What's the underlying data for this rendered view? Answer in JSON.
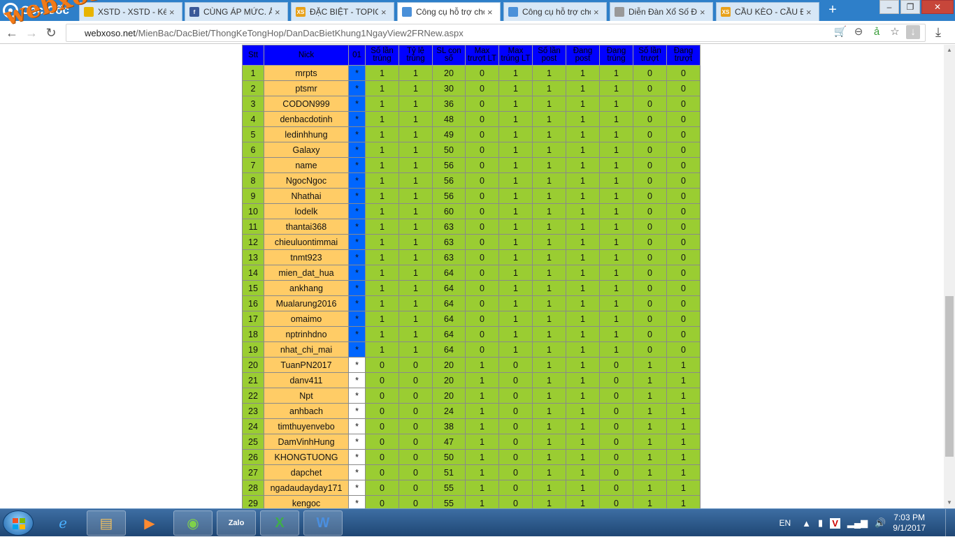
{
  "browser": {
    "brand": "Cốc Cốc",
    "watermark": "webxoso.net",
    "tabs": [
      {
        "title": "XSTD - XSTD - Kết",
        "icon": "chrome-icon",
        "favcolor": "#e8b400",
        "favtext": "",
        "active": false
      },
      {
        "title": "CÙNG ÁP MỨC. Ấn",
        "icon": "facebook-icon",
        "favcolor": "#3b5998",
        "favtext": "f",
        "active": false
      },
      {
        "title": "ĐẶC BIỆT - TOPIC",
        "icon": "xs-icon",
        "favcolor": "#e8a11a",
        "favtext": "XS",
        "active": false
      },
      {
        "title": "Công cụ hỗ trợ chơ",
        "icon": "tool-icon",
        "favcolor": "#4a90d9",
        "favtext": "",
        "active": true
      },
      {
        "title": "Công cụ hỗ trợ chơ",
        "icon": "tool-icon",
        "favcolor": "#4a90d9",
        "favtext": "",
        "active": false
      },
      {
        "title": "Diễn Đàn Xổ Số Đi",
        "icon": "page-icon",
        "favcolor": "#999999",
        "favtext": "",
        "active": false
      },
      {
        "title": "CẦU KÈO - CẦU ĐI",
        "icon": "xs-icon",
        "favcolor": "#e8a11a",
        "favtext": "XS",
        "active": false
      }
    ],
    "url_host": "webxoso.net",
    "url_path": "/MienBac/DacBiet/ThongKeTongHop/DanDacBietKhung1NgayView2FRNew.aspx"
  },
  "table": {
    "headers": [
      "Stt",
      "Nick",
      "01",
      "Số lần trúng",
      "Tỷ lệ trúng",
      "SL con số",
      "Max trượt LT",
      "Max trúng LT",
      "Số lần post",
      "Đang post",
      "Đang trúng",
      "Số lần trượt",
      "Đang trượt"
    ],
    "rows": [
      [
        "1",
        "mrpts",
        "*",
        "1",
        "1",
        "20",
        "0",
        "1",
        "1",
        "1",
        "1",
        "0",
        "0"
      ],
      [
        "2",
        "ptsmr",
        "*",
        "1",
        "1",
        "30",
        "0",
        "1",
        "1",
        "1",
        "1",
        "0",
        "0"
      ],
      [
        "3",
        "CODON999",
        "*",
        "1",
        "1",
        "36",
        "0",
        "1",
        "1",
        "1",
        "1",
        "0",
        "0"
      ],
      [
        "4",
        "denbacdotinh",
        "*",
        "1",
        "1",
        "48",
        "0",
        "1",
        "1",
        "1",
        "1",
        "0",
        "0"
      ],
      [
        "5",
        "ledinhhung",
        "*",
        "1",
        "1",
        "49",
        "0",
        "1",
        "1",
        "1",
        "1",
        "0",
        "0"
      ],
      [
        "6",
        "Galaxy",
        "*",
        "1",
        "1",
        "50",
        "0",
        "1",
        "1",
        "1",
        "1",
        "0",
        "0"
      ],
      [
        "7",
        "name",
        "*",
        "1",
        "1",
        "56",
        "0",
        "1",
        "1",
        "1",
        "1",
        "0",
        "0"
      ],
      [
        "8",
        "NgocNgoc",
        "*",
        "1",
        "1",
        "56",
        "0",
        "1",
        "1",
        "1",
        "1",
        "0",
        "0"
      ],
      [
        "9",
        "Nhathai",
        "*",
        "1",
        "1",
        "56",
        "0",
        "1",
        "1",
        "1",
        "1",
        "0",
        "0"
      ],
      [
        "10",
        "lodelk",
        "*",
        "1",
        "1",
        "60",
        "0",
        "1",
        "1",
        "1",
        "1",
        "0",
        "0"
      ],
      [
        "11",
        "thantai368",
        "*",
        "1",
        "1",
        "63",
        "0",
        "1",
        "1",
        "1",
        "1",
        "0",
        "0"
      ],
      [
        "12",
        "chieuluontimmai",
        "*",
        "1",
        "1",
        "63",
        "0",
        "1",
        "1",
        "1",
        "1",
        "0",
        "0"
      ],
      [
        "13",
        "tnmt923",
        "*",
        "1",
        "1",
        "63",
        "0",
        "1",
        "1",
        "1",
        "1",
        "0",
        "0"
      ],
      [
        "14",
        "mien_dat_hua",
        "*",
        "1",
        "1",
        "64",
        "0",
        "1",
        "1",
        "1",
        "1",
        "0",
        "0"
      ],
      [
        "15",
        "ankhang",
        "*",
        "1",
        "1",
        "64",
        "0",
        "1",
        "1",
        "1",
        "1",
        "0",
        "0"
      ],
      [
        "16",
        "Mualarung2016",
        "*",
        "1",
        "1",
        "64",
        "0",
        "1",
        "1",
        "1",
        "1",
        "0",
        "0"
      ],
      [
        "17",
        "omaimo",
        "*",
        "1",
        "1",
        "64",
        "0",
        "1",
        "1",
        "1",
        "1",
        "0",
        "0"
      ],
      [
        "18",
        "nptrinhdno",
        "*",
        "1",
        "1",
        "64",
        "0",
        "1",
        "1",
        "1",
        "1",
        "0",
        "0"
      ],
      [
        "19",
        "nhat_chi_mai",
        "*",
        "1",
        "1",
        "64",
        "0",
        "1",
        "1",
        "1",
        "1",
        "0",
        "0"
      ],
      [
        "20",
        "TuanPN2017",
        "*",
        "0",
        "0",
        "20",
        "1",
        "0",
        "1",
        "1",
        "0",
        "1",
        "1"
      ],
      [
        "21",
        "danv411",
        "*",
        "0",
        "0",
        "20",
        "1",
        "0",
        "1",
        "1",
        "0",
        "1",
        "1"
      ],
      [
        "22",
        "Npt",
        "*",
        "0",
        "0",
        "20",
        "1",
        "0",
        "1",
        "1",
        "0",
        "1",
        "1"
      ],
      [
        "23",
        "anhbach",
        "*",
        "0",
        "0",
        "24",
        "1",
        "0",
        "1",
        "1",
        "0",
        "1",
        "1"
      ],
      [
        "24",
        "timthuyenvebo",
        "*",
        "0",
        "0",
        "38",
        "1",
        "0",
        "1",
        "1",
        "0",
        "1",
        "1"
      ],
      [
        "25",
        "DamVinhHung",
        "*",
        "0",
        "0",
        "47",
        "1",
        "0",
        "1",
        "1",
        "0",
        "1",
        "1"
      ],
      [
        "26",
        "KHONGTUONG",
        "*",
        "0",
        "0",
        "50",
        "1",
        "0",
        "1",
        "1",
        "0",
        "1",
        "1"
      ],
      [
        "27",
        "dapchet",
        "*",
        "0",
        "0",
        "51",
        "1",
        "0",
        "1",
        "1",
        "0",
        "1",
        "1"
      ],
      [
        "28",
        "ngadaudayday171",
        "*",
        "0",
        "0",
        "55",
        "1",
        "0",
        "1",
        "1",
        "0",
        "1",
        "1"
      ],
      [
        "29",
        "kengoc",
        "*",
        "0",
        "0",
        "55",
        "1",
        "0",
        "1",
        "1",
        "0",
        "1",
        "1"
      ]
    ],
    "colors": {
      "header": "#0000ff",
      "stt": "#9acd32",
      "nick": "#ffcc66",
      "hit_mark": "#0066ff",
      "miss_mark": "#ffffff",
      "numbers": "#9acd32"
    }
  },
  "taskbar": {
    "lang": "EN",
    "time": "7:03 PM",
    "date": "9/1/2017"
  }
}
